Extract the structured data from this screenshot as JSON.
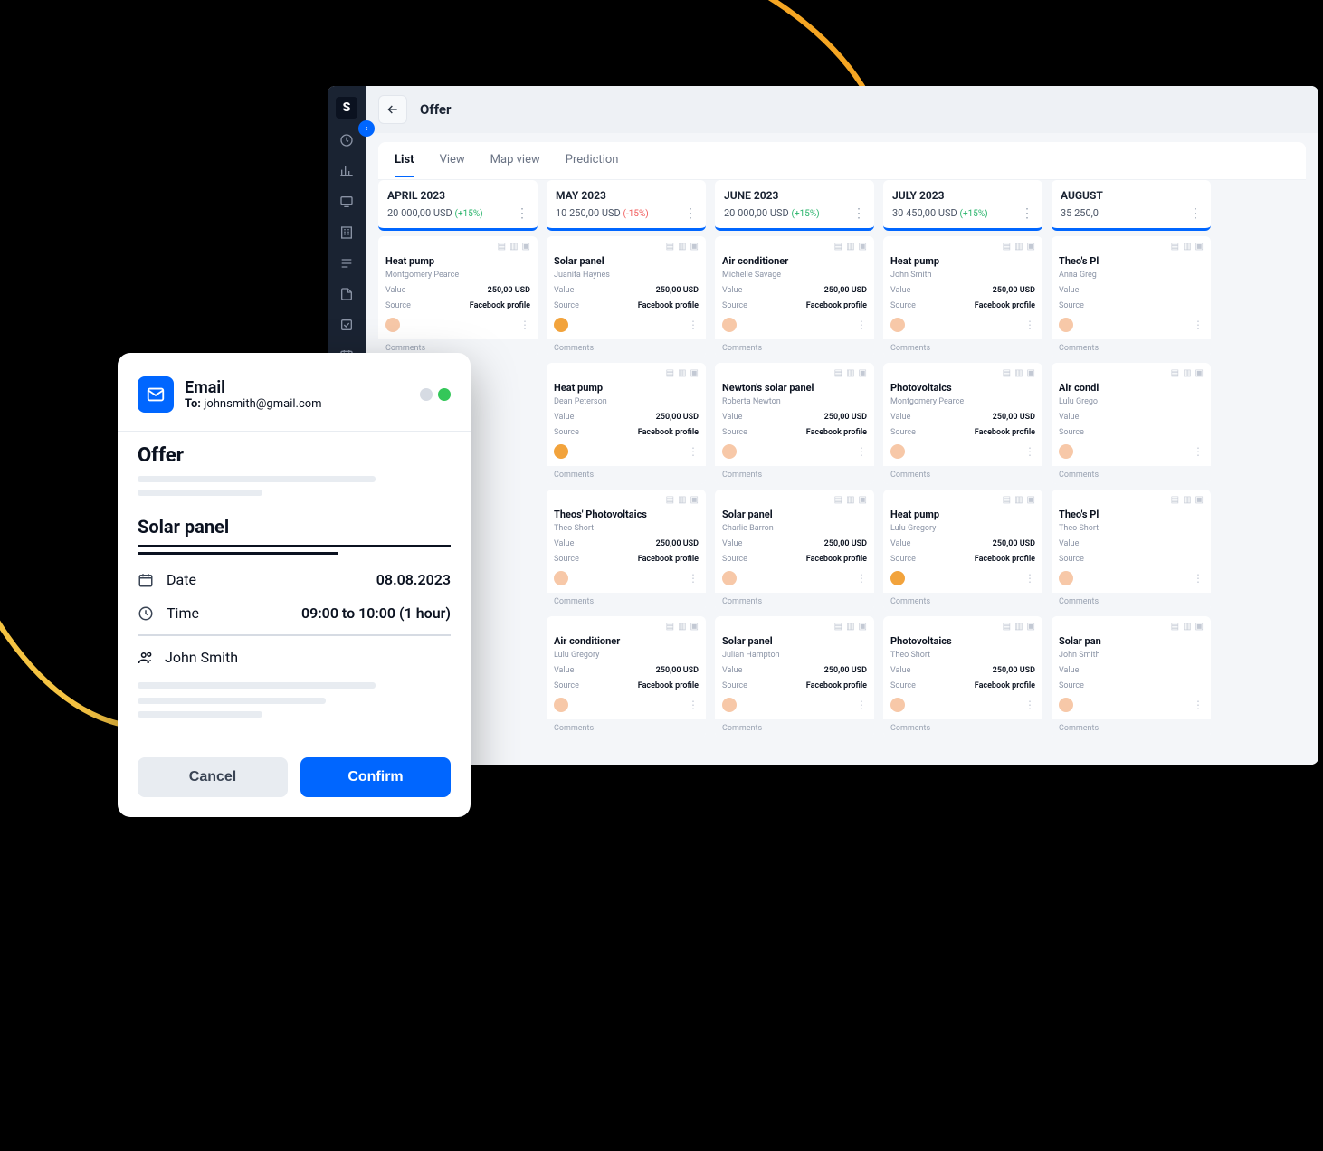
{
  "header": {
    "title": "Offer"
  },
  "tabs": [
    "List",
    "View",
    "Map view",
    "Prediction"
  ],
  "columns": [
    {
      "month": "APRIL 2023",
      "total": "20 000,00 USD",
      "delta": "(+15%)",
      "delta_sign": "pos",
      "cards": [
        {
          "title": "Heat pump",
          "client": "Montgomery Pearce",
          "value": "250,00 USD",
          "source": "Facebook profile",
          "avatar": "#f7c8a8"
        }
      ]
    },
    {
      "month": "MAY 2023",
      "total": "10 250,00 USD",
      "delta": "(-15%)",
      "delta_sign": "neg",
      "cards": [
        {
          "title": "Solar panel",
          "client": "Juanita Haynes",
          "value": "250,00 USD",
          "source": "Facebook profile",
          "avatar": "#f2a33c"
        },
        {
          "title": "Heat pump",
          "client": "Dean Peterson",
          "value": "250,00 USD",
          "source": "Facebook profile",
          "avatar": "#f2a33c"
        },
        {
          "title": "Theos' Photovoltaics",
          "client": "Theo Short",
          "value": "250,00 USD",
          "source": "Facebook profile",
          "avatar": "#f7c8a8"
        },
        {
          "title": "Air conditioner",
          "client": "Lulu Gregory",
          "value": "250,00 USD",
          "source": "Facebook profile",
          "avatar": "#f7c8a8"
        }
      ]
    },
    {
      "month": "JUNE 2023",
      "total": "20 000,00 USD",
      "delta": "(+15%)",
      "delta_sign": "pos",
      "cards": [
        {
          "title": "Air conditioner",
          "client": "Michelle Savage",
          "value": "250,00 USD",
          "source": "Facebook profile",
          "avatar": "#f7c8a8"
        },
        {
          "title": "Newton's solar panel",
          "client": "Roberta Newton",
          "value": "250,00 USD",
          "source": "Facebook profile",
          "avatar": "#f7c8a8"
        },
        {
          "title": "Solar panel",
          "client": "Charlie Barron",
          "value": "250,00 USD",
          "source": "Facebook profile",
          "avatar": "#f7c8a8"
        },
        {
          "title": "Solar panel",
          "client": "Julian Hampton",
          "value": "250,00 USD",
          "source": "Facebook profile",
          "avatar": "#f7c8a8"
        }
      ]
    },
    {
      "month": "JULY 2023",
      "total": "30 450,00 USD",
      "delta": "(+15%)",
      "delta_sign": "pos",
      "cards": [
        {
          "title": "Heat pump",
          "client": "John Smith",
          "value": "250,00 USD",
          "source": "Facebook profile",
          "avatar": "#f7c8a8"
        },
        {
          "title": "Photovoltaics",
          "client": "Montgomery Pearce",
          "value": "250,00 USD",
          "source": "Facebook profile",
          "avatar": "#f7c8a8"
        },
        {
          "title": "Heat pump",
          "client": "Lulu Gregory",
          "value": "250,00 USD",
          "source": "Facebook profile",
          "avatar": "#f2a33c"
        },
        {
          "title": "Photovoltaics",
          "client": "Theo Short",
          "value": "250,00 USD",
          "source": "Facebook profile",
          "avatar": "#f7c8a8"
        }
      ]
    },
    {
      "month": "AUGUST",
      "total": "35 250,0",
      "delta": "",
      "delta_sign": "pos",
      "cards": [
        {
          "title": "Theo's Pl",
          "client": "Anna Greg",
          "value": "",
          "source": "",
          "avatar": "#f7c8a8"
        },
        {
          "title": "Air condi",
          "client": "Lulu Grego",
          "value": "",
          "source": "",
          "avatar": "#f7c8a8"
        },
        {
          "title": "Theo's Pl",
          "client": "Theo Short",
          "value": "",
          "source": "",
          "avatar": "#f7c8a8"
        },
        {
          "title": "Solar pan",
          "client": "John Smith",
          "value": "",
          "source": "",
          "avatar": "#f7c8a8"
        }
      ]
    }
  ],
  "card_labels": {
    "value": "Value",
    "source": "Source",
    "comments": "Comments"
  },
  "popup": {
    "channel": "Email",
    "to_prefix": "To:",
    "to": "johnsmith@gmail.com",
    "heading": "Offer",
    "product": "Solar panel",
    "date_label": "Date",
    "date": "08.08.2023",
    "time_label": "Time",
    "time": "09:00 to 10:00 (1 hour)",
    "person": "John Smith",
    "cancel": "Cancel",
    "confirm": "Confirm"
  }
}
